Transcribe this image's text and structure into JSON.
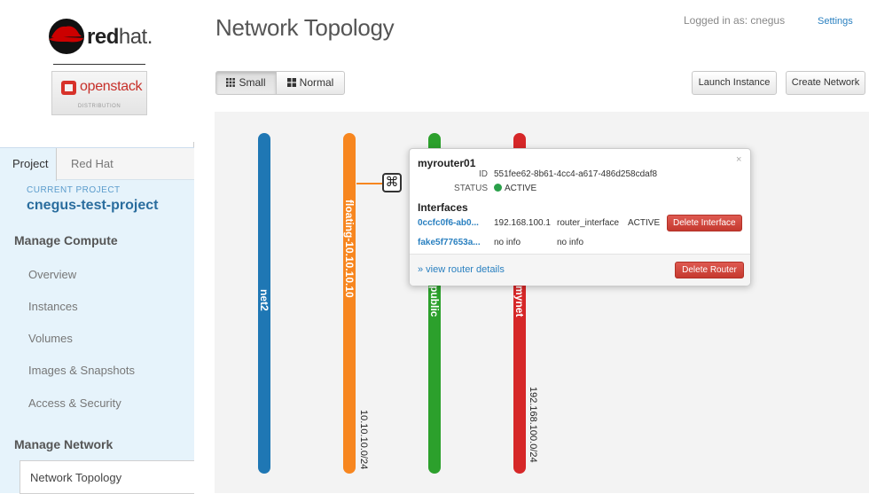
{
  "brand": {
    "redhat_bold": "red",
    "redhat_light": "hat.",
    "openstack": "openstack",
    "distribution": "DISTRIBUTION"
  },
  "tabs": {
    "project": "Project",
    "redhat": "Red Hat"
  },
  "current_project": {
    "label": "CURRENT PROJECT",
    "name": "cnegus-test-project"
  },
  "nav": {
    "manage_compute": "Manage Compute",
    "compute_items": [
      "Overview",
      "Instances",
      "Volumes",
      "Images & Snapshots",
      "Access & Security"
    ],
    "manage_network": "Manage Network",
    "network_items": [
      "Network Topology"
    ]
  },
  "header": {
    "title": "Network Topology",
    "logged_in": "Logged in as: cnegus",
    "settings": "Settings"
  },
  "toolbar": {
    "small": "Small",
    "normal": "Normal",
    "launch": "Launch Instance",
    "create": "Create Network"
  },
  "networks": [
    {
      "name": "net2",
      "color": "#1f77b4",
      "cidr": ""
    },
    {
      "name": "floating-10.10.10.10",
      "color": "#f7861f",
      "cidr": "10.10.10.0/24"
    },
    {
      "name": "public",
      "color": "#2ca02c",
      "cidr": ""
    },
    {
      "name": "mynet",
      "color": "#d62728",
      "cidr": "192.168.100.0/24"
    }
  ],
  "popup": {
    "title": "myrouter01",
    "id_label": "ID",
    "id": "551fee62-8b61-4cc4-a617-486d258cdaf8",
    "status_label": "STATUS",
    "status": "ACTIVE",
    "status_color": "#2aa04a",
    "interfaces_label": "Interfaces",
    "interfaces": [
      {
        "id": "0ccfc0f6-ab0...",
        "ip": "192.168.100.1",
        "type": "router_interface",
        "status": "ACTIVE",
        "action": "Delete Interface"
      },
      {
        "id": "fake5f77653a...",
        "ip": "no info",
        "type": "no info",
        "status": "",
        "action": ""
      }
    ],
    "view_details": "» view router details",
    "delete_router": "Delete Router",
    "close": "×"
  }
}
